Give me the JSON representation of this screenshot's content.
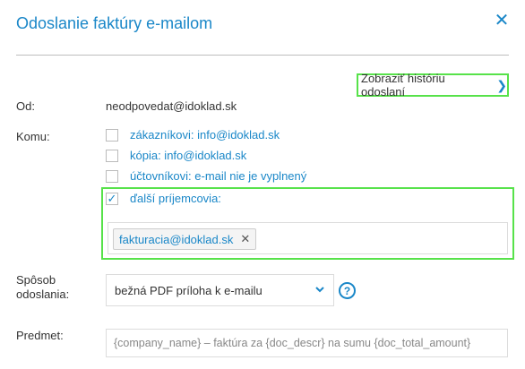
{
  "dialog": {
    "title": "Odoslanie faktúry e-mailom",
    "close_icon": "close-icon"
  },
  "history_link": {
    "label": "Zobraziť históriu odoslaní"
  },
  "from": {
    "label": "Od:",
    "value": "neodpovedat@idoklad.sk"
  },
  "to": {
    "label": "Komu:",
    "options": [
      {
        "label": "zákazníkovi: info@idoklad.sk",
        "checked": false
      },
      {
        "label": "kópia: info@idoklad.sk",
        "checked": false
      },
      {
        "label": "účtovníkovi: e-mail nie je vyplnený",
        "checked": false
      },
      {
        "label": "ďalší príjemcovia:",
        "checked": true
      }
    ],
    "recipients": [
      "fakturacia@idoklad.sk"
    ]
  },
  "send_method": {
    "label_line1": "Spôsob",
    "label_line2": "odoslania:",
    "selected": "bežná PDF príloha k e-mailu"
  },
  "subject": {
    "label": "Predmet:",
    "value": "{company_name} – faktúra za {doc_descr} na sumu {doc_total_amount}"
  }
}
